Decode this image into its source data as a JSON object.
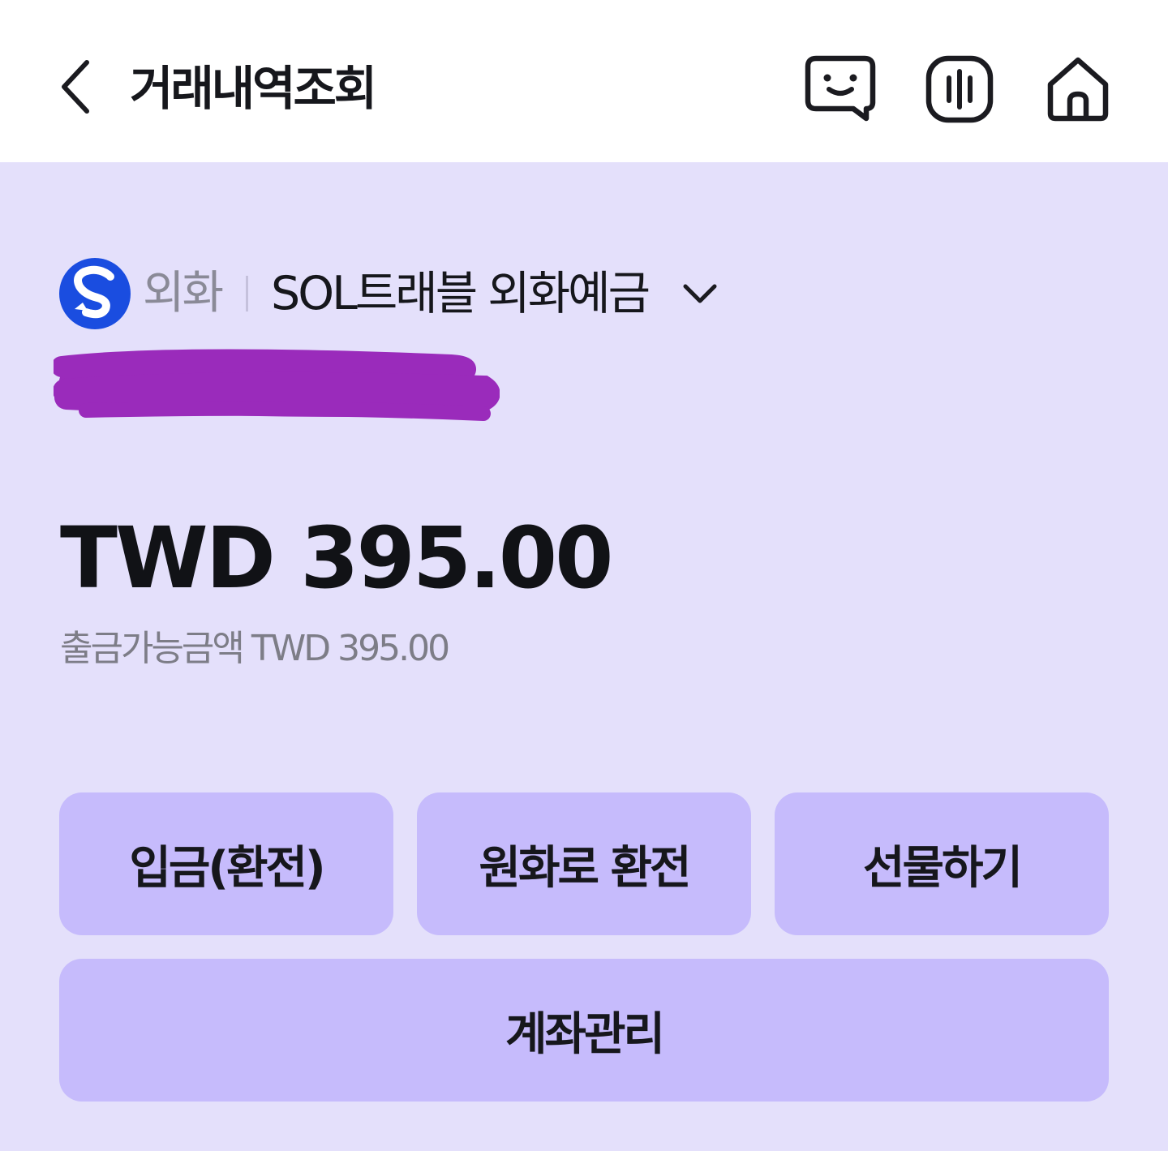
{
  "header": {
    "title": "거래내역조회",
    "back_icon": "chevron-left-icon",
    "icons": [
      "chat-bot-icon",
      "voice-assistant-icon",
      "home-icon"
    ]
  },
  "account": {
    "bank_logo": "shinhan-bank-logo",
    "category": "외화",
    "product_name": "SOL트래블 외화예금",
    "account_number_redacted": true
  },
  "balance": {
    "amount": "TWD 395.00",
    "available": "출금가능금액 TWD 395.00"
  },
  "actions": {
    "deposit": "입금(환전)",
    "to_krw": "원화로 환전",
    "gift": "선물하기",
    "manage": "계좌관리"
  },
  "colors": {
    "background": "#e4e0fb",
    "button": "#c6bbfc",
    "text": "#16171c",
    "logo_blue": "#1a4de0",
    "redaction": "#9a2bbb"
  }
}
